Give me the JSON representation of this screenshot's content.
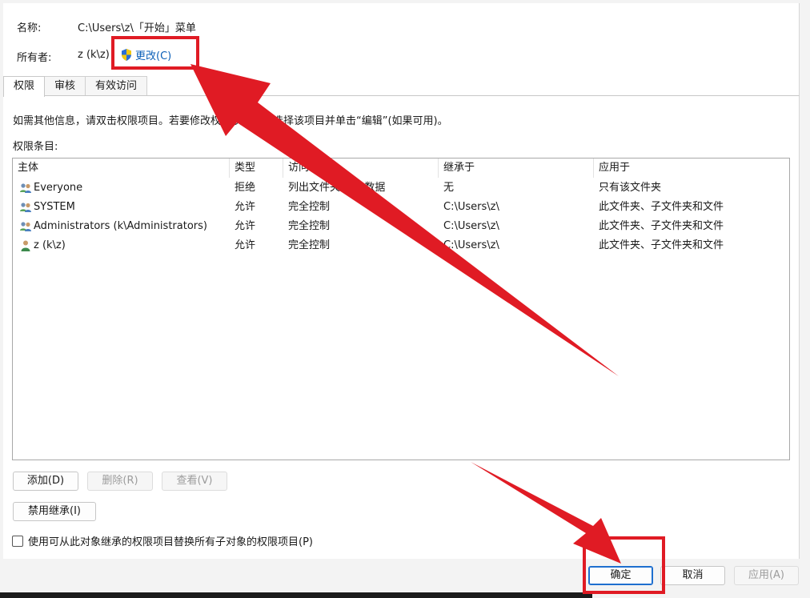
{
  "header": {
    "name_label": "名称:",
    "name_value": "C:\\Users\\z\\「开始」菜单",
    "owner_label": "所有者:",
    "owner_value": "z (k\\z)",
    "change_link": "更改(C)"
  },
  "tabs": [
    {
      "label": "权限",
      "active": true
    },
    {
      "label": "审核",
      "active": false
    },
    {
      "label": "有效访问",
      "active": false
    }
  ],
  "permissions": {
    "info_text": "如需其他信息，请双击权限项目。若要修改权限项目，请选择该项目并单击“编辑”(如果可用)。",
    "entries_label": "权限条目:",
    "columns": [
      "主体",
      "类型",
      "访问",
      "继承于",
      "应用于"
    ],
    "rows": [
      {
        "principal": "Everyone",
        "icon": "group-icon",
        "type": "拒绝",
        "access": "列出文件夹/读取数据",
        "inherited": "无",
        "applies": "只有该文件夹"
      },
      {
        "principal": "SYSTEM",
        "icon": "group-icon",
        "type": "允许",
        "access": "完全控制",
        "inherited": "C:\\Users\\z\\",
        "applies": "此文件夹、子文件夹和文件"
      },
      {
        "principal": "Administrators (k\\Administrators)",
        "icon": "group-icon",
        "type": "允许",
        "access": "完全控制",
        "inherited": "C:\\Users\\z\\",
        "applies": "此文件夹、子文件夹和文件"
      },
      {
        "principal": "z (k\\z)",
        "icon": "user-icon",
        "type": "允许",
        "access": "完全控制",
        "inherited": "C:\\Users\\z\\",
        "applies": "此文件夹、子文件夹和文件"
      }
    ],
    "add_button": "添加(D)",
    "remove_button": "删除(R)",
    "view_button": "查看(V)",
    "disable_inheritance_button": "禁用继承(I)",
    "replace_checkbox_label": "使用可从此对象继承的权限项目替换所有子对象的权限项目(P)",
    "replace_checkbox_checked": false
  },
  "footer": {
    "ok_button": "确定",
    "cancel_button": "取消",
    "apply_button": "应用(A)"
  },
  "colors": {
    "annotation": "#e01b24",
    "link": "#0b5fb8"
  }
}
